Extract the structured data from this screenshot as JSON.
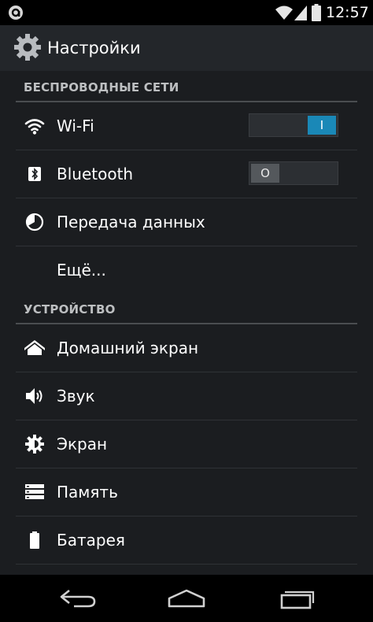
{
  "status_bar": {
    "time": "12:57",
    "icons": [
      "notification-app-icon",
      "wifi-icon",
      "signal-icon",
      "battery-icon"
    ]
  },
  "action_bar": {
    "title": "Настройки",
    "icon": "gear-icon"
  },
  "sections": [
    {
      "header": "БЕСПРОВОДНЫЕ СЕТИ",
      "items": [
        {
          "label": "Wi-Fi",
          "icon": "wifi-icon",
          "toggle": "I",
          "toggle_state": "on"
        },
        {
          "label": "Bluetooth",
          "icon": "bluetooth-icon",
          "toggle": "O",
          "toggle_state": "off"
        },
        {
          "label": "Передача данных",
          "icon": "data-usage-icon"
        },
        {
          "label": "Ещё..."
        }
      ]
    },
    {
      "header": "УСТРОЙСТВО",
      "items": [
        {
          "label": "Домашний экран",
          "icon": "home-icon"
        },
        {
          "label": "Звук",
          "icon": "speaker-icon"
        },
        {
          "label": "Экран",
          "icon": "brightness-icon"
        },
        {
          "label": "Память",
          "icon": "storage-icon"
        },
        {
          "label": "Батарея",
          "icon": "battery-icon"
        }
      ]
    }
  ],
  "nav_bar": {
    "buttons": [
      "back-icon",
      "home-icon",
      "recent-apps-icon"
    ]
  },
  "colors": {
    "accent": "#1a88b7",
    "background": "#1b1d20",
    "action_bar": "#23262a",
    "section_text": "#bdbfc1"
  }
}
